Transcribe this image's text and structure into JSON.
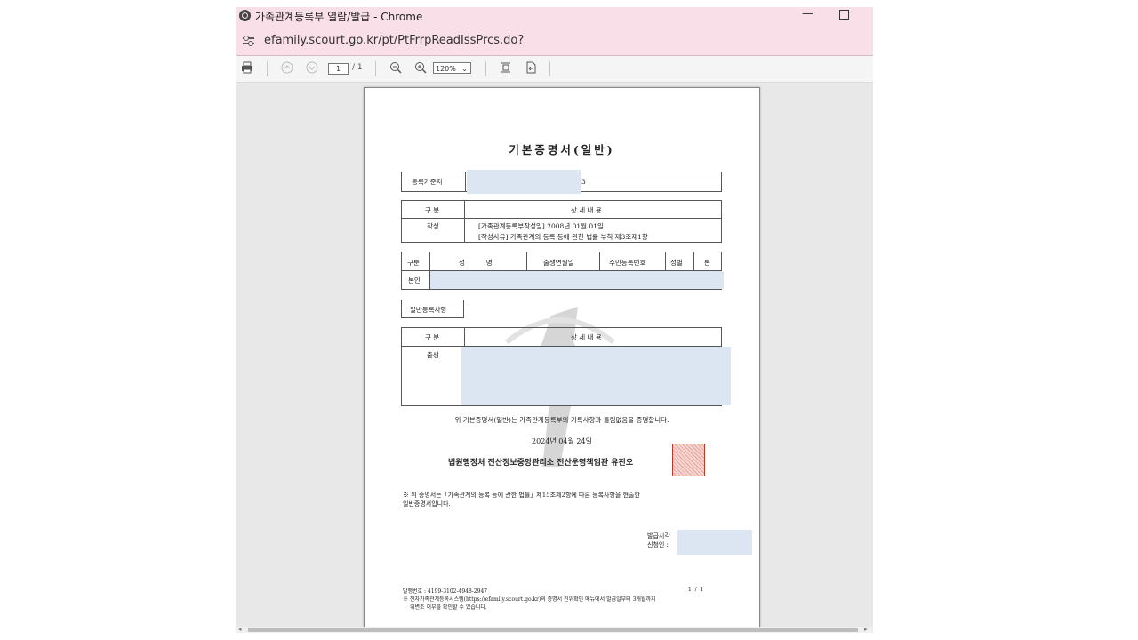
{
  "window": {
    "title": "가족관계등록부 열람/발급 - Chrome",
    "url": "efamily.scourt.go.kr/pt/PtFrrpReadIssPrcs.do?",
    "minimize_symbol": "—",
    "icons": [
      "globe-icon",
      "site-settings-icon",
      "minimize-icon",
      "maximize-icon"
    ]
  },
  "toolbar": {
    "page_current": "1",
    "page_total": "/ 1",
    "zoom": "120%",
    "icons": [
      "print-icon",
      "prev-page-icon",
      "next-page-icon",
      "zoom-out-icon",
      "zoom-in-icon",
      "fit-page-icon",
      "fit-width-icon"
    ]
  },
  "document": {
    "title": "기본증명서(일반)",
    "reg_label": "등록기준지",
    "reg_value_suffix": "3",
    "sec1_col1": "구 분",
    "sec1_col2": "상 세 내 용",
    "sec1_row_label": "작성",
    "sec1_line1": "[가족관계등록부작성일]    2008년 01월 01일",
    "sec1_line2": "[작성사유]   가족관계의 등록 등에 관한 법률 부칙 제3조제1항",
    "t2_h1": "구분",
    "t2_h2": "성          명",
    "t2_h3": "출생연월일",
    "t2_h4": "주민등록번호",
    "t2_h5": "성별",
    "t2_h6": "본",
    "t2_row_label": "본인",
    "general_label": "일반등록사항",
    "t3_h1": "구 분",
    "t3_h2": "상 세 내 용",
    "t3_row_label": "출생",
    "certify_text": "위 기본증명서(일반)는 가족관계등록부의 기록사항과 틀림없음을 증명합니다.",
    "date": "2024년 04월 24일",
    "issuer": "법원행정처 전산정보중앙관리소 전산운영책임관 유진오",
    "note_line1": "※ 위 증명서는「가족관계의 등록 등에 관한 법률」제15조제2항에 따른 등록사항을 현출한",
    "note_line2": "일반증명서입니다.",
    "issuer_label1": "발급시각",
    "issuer_label2": "신청인 :",
    "footer_no": "발행번호 : 4199-3102-4948-2947",
    "footer_page": "1  /  1",
    "footer_note1": "※ 전자가족관계등록시스템(https://efamily.scourt.go.kr)의 증명서 진위확인 메뉴에서 발급일부터 3개월까지",
    "footer_note2": "위변조 여부를 확인할 수 있습니다."
  },
  "colors": {
    "chrome_frame": "#f9dfe8",
    "viewer_bg": "#e8e8e8",
    "redaction": "#dce6f2",
    "seal": "#c0392b"
  }
}
